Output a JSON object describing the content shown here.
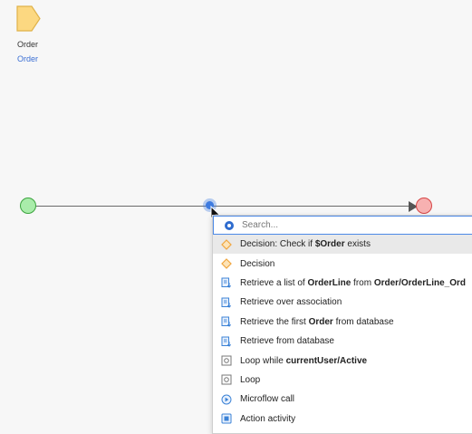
{
  "parameter": {
    "name": "Order",
    "type": "Order",
    "icon": "parameter-icon",
    "fill_color": "#fcd881",
    "stroke_color": "#e0b24a"
  },
  "flow": {
    "start_icon": "start-event-icon",
    "end_icon": "end-event-icon",
    "insert_icon": "insertion-point-icon"
  },
  "search": {
    "placeholder": "Search..."
  },
  "menu_items": [
    {
      "icon": "decision-icon",
      "parts": [
        "Decision: Check if ",
        "$Order",
        " exists"
      ],
      "bold": [
        false,
        true,
        false
      ]
    },
    {
      "icon": "decision-icon",
      "parts": [
        "Decision"
      ],
      "bold": [
        false
      ]
    },
    {
      "icon": "retrieve-icon",
      "parts": [
        "Retrieve a list of ",
        "OrderLine",
        " from ",
        "Order/OrderLine_Ord"
      ],
      "bold": [
        false,
        true,
        false,
        true
      ]
    },
    {
      "icon": "retrieve-icon",
      "parts": [
        "Retrieve over association"
      ],
      "bold": [
        false
      ]
    },
    {
      "icon": "retrieve-icon",
      "parts": [
        "Retrieve the first ",
        "Order",
        " from database"
      ],
      "bold": [
        false,
        true,
        false
      ]
    },
    {
      "icon": "retrieve-icon",
      "parts": [
        "Retrieve from database"
      ],
      "bold": [
        false
      ]
    },
    {
      "icon": "loop-icon",
      "parts": [
        "Loop while ",
        "currentUser/Active"
      ],
      "bold": [
        false,
        true
      ]
    },
    {
      "icon": "loop-icon",
      "parts": [
        "Loop"
      ],
      "bold": [
        false
      ]
    },
    {
      "icon": "microflow-call-icon",
      "parts": [
        "Microflow call"
      ],
      "bold": [
        false
      ]
    },
    {
      "icon": "action-activity-icon",
      "parts": [
        "Action activity"
      ],
      "bold": [
        false
      ]
    }
  ],
  "colors": {
    "accent": "#3e7be0",
    "decision": "#f0a640",
    "activity": "#3b82d6",
    "loop": "#777777"
  }
}
